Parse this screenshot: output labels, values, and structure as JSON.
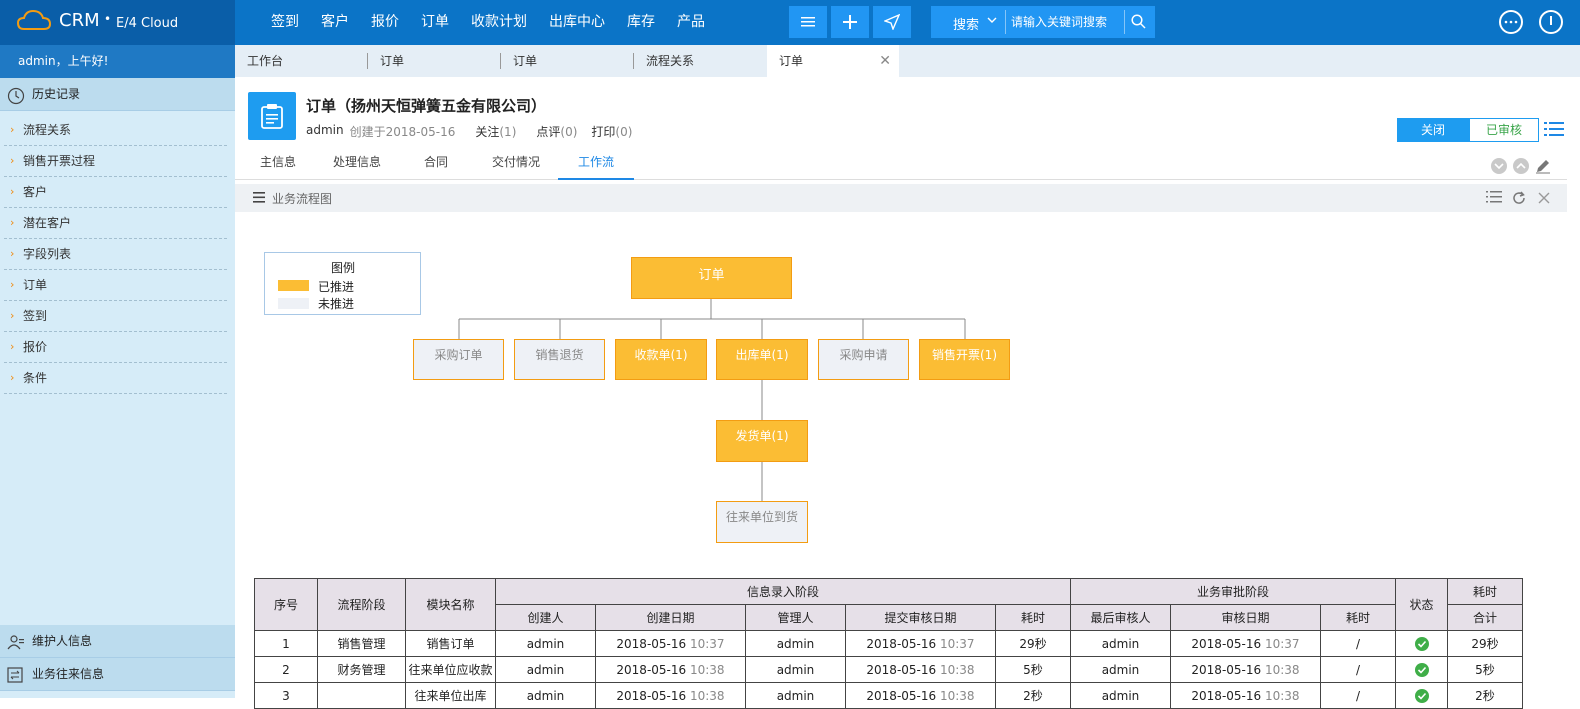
{
  "brand": {
    "name": "CRM",
    "dot": "•",
    "subtitle": "E/4 Cloud"
  },
  "top_nav": [
    "签到",
    "客户",
    "报价",
    "订单",
    "收款计划",
    "出库中心",
    "库存",
    "产品"
  ],
  "search": {
    "type_label": "搜索",
    "placeholder": "请输入关键词搜索"
  },
  "sidebar": {
    "greeting": "admin，上午好!",
    "history_title": "历史记录",
    "items": [
      "流程关系",
      "销售开票过程",
      "客户",
      "潜在客户",
      "字段列表",
      "订单",
      "签到",
      "报价",
      "条件"
    ],
    "bottom": [
      "维护人信息",
      "业务往来信息"
    ]
  },
  "tabs": [
    "工作台",
    "订单",
    "订单",
    "流程关系",
    "订单"
  ],
  "order": {
    "title": "订单（扬州天恒弹簧五金有限公司）",
    "user": "admin",
    "created": "创建于2018-05-16",
    "follow_label": "关注",
    "follow_count": "(1)",
    "comment_label": "点评",
    "comment_count": "(0)",
    "print_label": "打印",
    "print_count": "(0)"
  },
  "actions": {
    "close": "关闭",
    "approved": "已审核"
  },
  "subtabs": [
    "主信息",
    "处理信息",
    "合同",
    "交付情况",
    "工作流"
  ],
  "panel": {
    "title": "业务流程图"
  },
  "legend": {
    "title": "图例",
    "done": "已推进",
    "todo": "未推进",
    "done_color": "#fbbd34",
    "todo_color": "#eef1f6"
  },
  "flow": {
    "root": "订单",
    "level1": [
      "采购订单",
      "销售退货",
      "收款单(1)",
      "出库单(1)",
      "采购申请",
      "销售开票(1)"
    ],
    "level2": "发货单(1)",
    "level3": "往来单位到货"
  },
  "table": {
    "headers": {
      "seq": "序号",
      "stage": "流程阶段",
      "module": "模块名称",
      "entry_group": "信息录入阶段",
      "approval_group": "业务审批阶段",
      "status": "状态",
      "total_a": "耗时",
      "total_b": "合计",
      "creator": "创建人",
      "create_date": "创建日期",
      "manager": "管理人",
      "submit_date": "提交审核日期",
      "entry_time": "耗时",
      "last_reviewer": "最后审核人",
      "review_date": "审核日期",
      "approval_time": "耗时"
    },
    "rows": [
      {
        "seq": "1",
        "stage": "销售管理",
        "module": "销售订单",
        "creator": "admin",
        "create_date": "2018-05-16",
        "create_time": "10:37",
        "manager": "admin",
        "submit_date": "2018-05-16",
        "submit_time": "10:37",
        "entry_time": "29秒",
        "reviewer": "admin",
        "review_date": "2018-05-16",
        "review_time": "10:37",
        "approval_time": "/",
        "total": "29秒"
      },
      {
        "seq": "2",
        "stage": "财务管理",
        "module": "往来单位应收款",
        "creator": "admin",
        "create_date": "2018-05-16",
        "create_time": "10:38",
        "manager": "admin",
        "submit_date": "2018-05-16",
        "submit_time": "10:38",
        "entry_time": "5秒",
        "reviewer": "admin",
        "review_date": "2018-05-16",
        "review_time": "10:38",
        "approval_time": "/",
        "total": "5秒"
      },
      {
        "seq": "3",
        "stage": "",
        "module": "往来单位出库",
        "creator": "admin",
        "create_date": "2018-05-16",
        "create_time": "10:38",
        "manager": "admin",
        "submit_date": "2018-05-16",
        "submit_time": "10:38",
        "entry_time": "2秒",
        "reviewer": "admin",
        "review_date": "2018-05-16",
        "review_time": "10:38",
        "approval_time": "/",
        "total": "2秒"
      }
    ]
  },
  "colors": {
    "topbar": "#0b74c7",
    "accent": "#1e9cf0",
    "done": "#fbbd34",
    "ok": "#3fae48"
  },
  "icons": [
    "cloud-icon",
    "menu-icon",
    "plus-icon",
    "send-icon",
    "chevron-down-icon",
    "search-icon",
    "more-icon",
    "power-icon",
    "clock-icon",
    "clipboard-icon",
    "list-icon",
    "refresh-icon",
    "close-icon",
    "edit-icon",
    "person-icon",
    "exchange-icon",
    "check-icon"
  ]
}
